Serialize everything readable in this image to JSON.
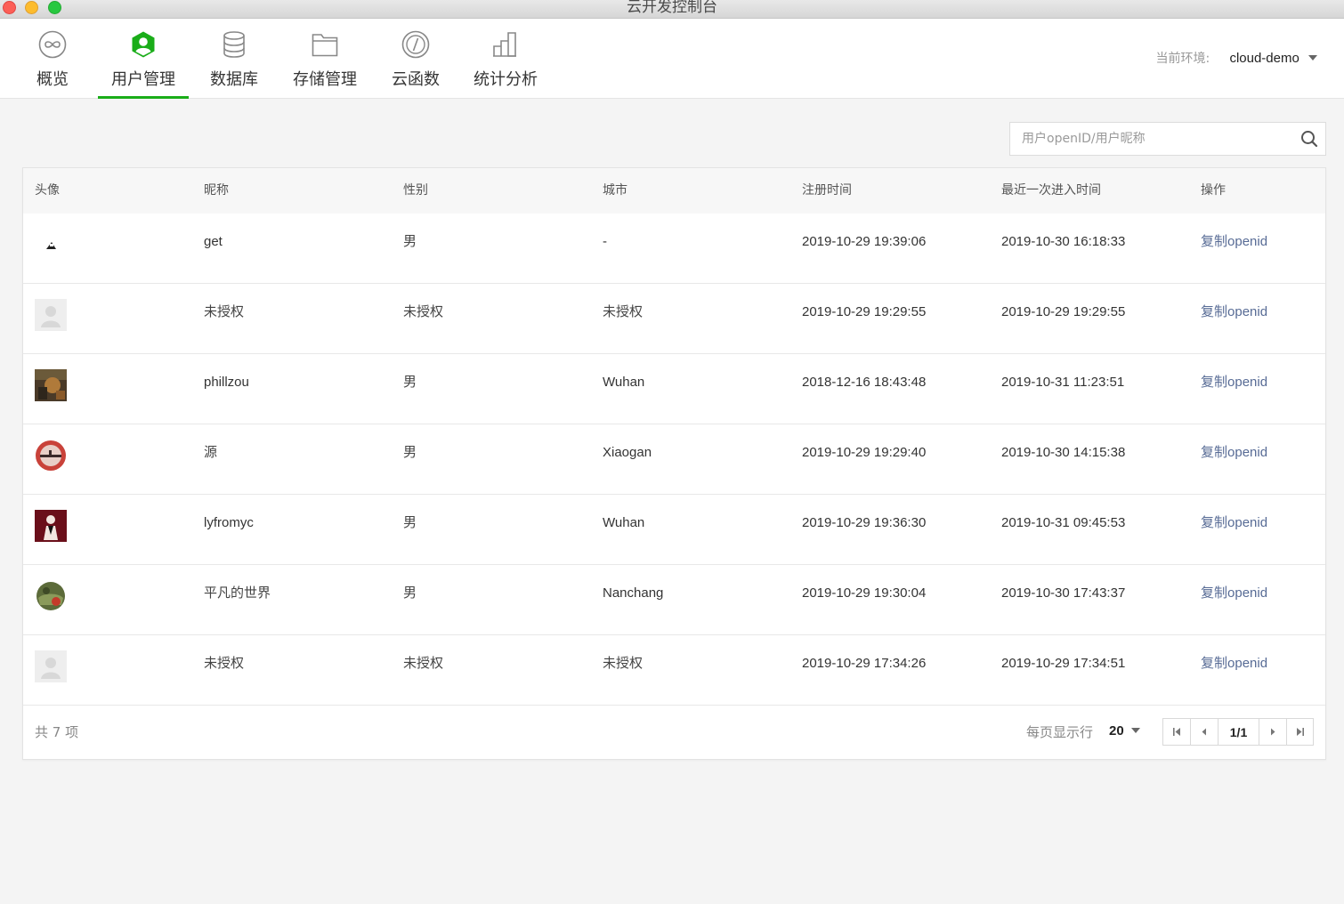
{
  "window": {
    "title": "云开发控制台"
  },
  "nav": {
    "items": [
      {
        "label": "概览",
        "icon": "overview-icon"
      },
      {
        "label": "用户管理",
        "icon": "user-icon",
        "active": true
      },
      {
        "label": "数据库",
        "icon": "database-icon"
      },
      {
        "label": "存储管理",
        "icon": "storage-icon"
      },
      {
        "label": "云函数",
        "icon": "function-icon"
      },
      {
        "label": "统计分析",
        "icon": "stats-icon"
      }
    ],
    "env_label": "当前环境:",
    "env_value": "cloud-demo"
  },
  "search": {
    "placeholder": "用户openID/用户昵称"
  },
  "table": {
    "headers": [
      "头像",
      "昵称",
      "性别",
      "城市",
      "注册时间",
      "最近一次进入时间",
      "操作"
    ],
    "rows": [
      {
        "avatar": "avatar-small-dark",
        "nickname": "get",
        "gender": "男",
        "city": "-",
        "registered": "2019-10-29 19:39:06",
        "last_visit": "2019-10-30 16:18:33",
        "action_zh": "复制",
        "action_en": "openid"
      },
      {
        "avatar": "avatar-placeholder",
        "nickname": "未授权",
        "gender": "未授权",
        "city": "未授权",
        "registered": "2019-10-29 19:29:55",
        "last_visit": "2019-10-29 19:29:55",
        "action_zh": "复制",
        "action_en": "openid"
      },
      {
        "avatar": "avatar-photo-brown",
        "nickname": "phillzou",
        "gender": "男",
        "city": "Wuhan",
        "registered": "2018-12-16 18:43:48",
        "last_visit": "2019-10-31 11:23:51",
        "action_zh": "复制",
        "action_en": "openid"
      },
      {
        "avatar": "avatar-photo-red-circle",
        "nickname": "源",
        "gender": "男",
        "city": "Xiaogan",
        "registered": "2019-10-29 19:29:40",
        "last_visit": "2019-10-30 14:15:38",
        "action_zh": "复制",
        "action_en": "openid"
      },
      {
        "avatar": "avatar-photo-portrait",
        "nickname": "lyfromyc",
        "gender": "男",
        "city": "Wuhan",
        "registered": "2019-10-29 19:36:30",
        "last_visit": "2019-10-31 09:45:53",
        "action_zh": "复制",
        "action_en": "openid"
      },
      {
        "avatar": "avatar-photo-green-circle",
        "nickname": "平凡的世界",
        "gender": "男",
        "city": "Nanchang",
        "registered": "2019-10-29 19:30:04",
        "last_visit": "2019-10-30 17:43:37",
        "action_zh": "复制",
        "action_en": "openid"
      },
      {
        "avatar": "avatar-placeholder",
        "nickname": "未授权",
        "gender": "未授权",
        "city": "未授权",
        "registered": "2019-10-29 17:34:26",
        "last_visit": "2019-10-29 17:34:51",
        "action_zh": "复制",
        "action_en": "openid"
      }
    ]
  },
  "footer": {
    "total": "共 7 项",
    "per_page_label": "每页显示行",
    "per_page_value": "20",
    "page": "1/1"
  },
  "colors": {
    "accent": "#1aad19",
    "link": "#576b95"
  }
}
